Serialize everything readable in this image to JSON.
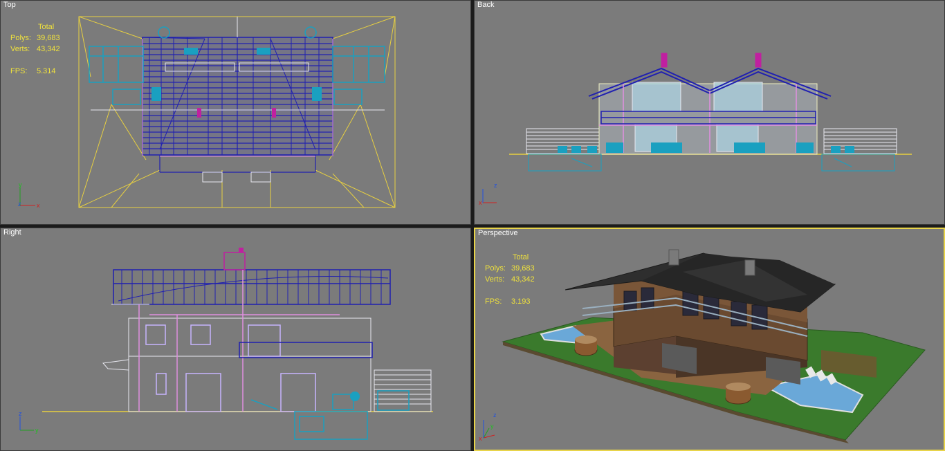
{
  "viewports": {
    "top": {
      "label": "Top"
    },
    "back": {
      "label": "Back"
    },
    "right": {
      "label": "Right"
    },
    "perspective": {
      "label": "Perspective"
    }
  },
  "stats_top": {
    "total_label": "Total",
    "polys_label": "Polys:",
    "polys_value": "39,683",
    "verts_label": "Verts:",
    "verts_value": "43,342",
    "fps_label": "FPS:",
    "fps_value": "5.314"
  },
  "stats_perspective": {
    "total_label": "Total",
    "polys_label": "Polys:",
    "polys_value": "39,683",
    "verts_label": "Verts:",
    "verts_value": "43,342",
    "fps_label": "FPS:",
    "fps_value": "3.193"
  },
  "axes": {
    "top": {
      "x": "x",
      "y": "y",
      "z": "z"
    },
    "back": {
      "x": "x",
      "z": "z"
    },
    "right": {
      "y": "y",
      "z": "z"
    },
    "perspective": {
      "x": "x",
      "y": "y",
      "z": "z"
    }
  },
  "colors": {
    "viewport_bg": "#7b7b7b",
    "active_border": "#e8d44a",
    "stats_text": "#f0e23c",
    "wire_blue": "#2020b0",
    "wire_cyan": "#1aa0c0",
    "wire_pink": "#e090e0",
    "wire_yellow": "#e8d040",
    "wire_white": "#e8e8f0"
  }
}
